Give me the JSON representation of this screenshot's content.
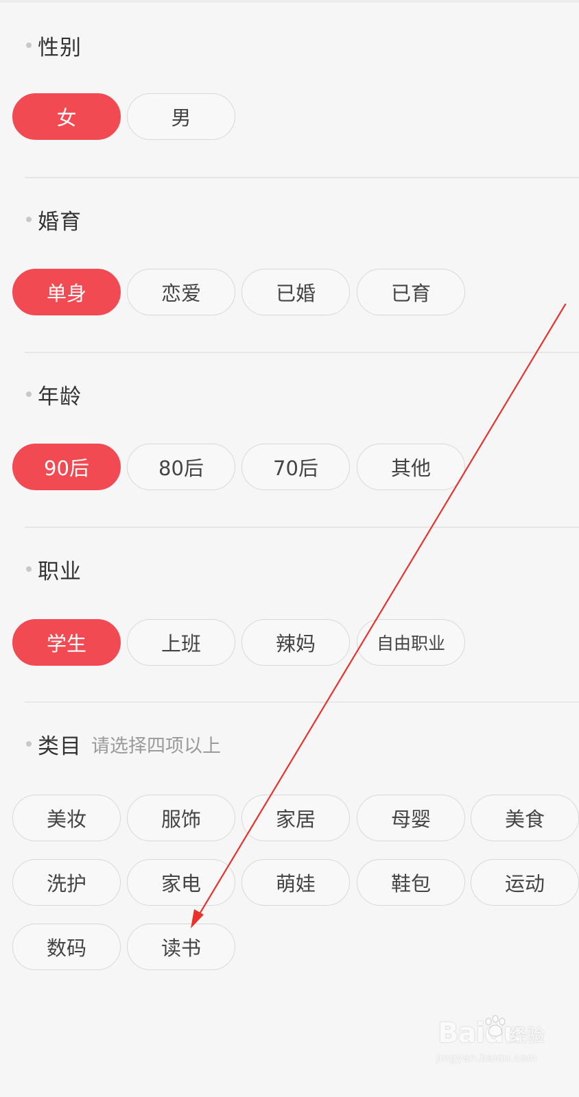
{
  "sections": {
    "gender": {
      "title": "性别",
      "options": [
        "女",
        "男"
      ],
      "selected": "女"
    },
    "marital": {
      "title": "婚育",
      "options": [
        "单身",
        "恋爱",
        "已婚",
        "已育"
      ],
      "selected": "单身"
    },
    "age": {
      "title": "年龄",
      "options": [
        "90后",
        "80后",
        "70后",
        "其他"
      ],
      "selected": "90后"
    },
    "occupation": {
      "title": "职业",
      "options": [
        "学生",
        "上班",
        "辣妈",
        "自由职业"
      ],
      "selected": "学生"
    },
    "category": {
      "title": "类目",
      "hint": "请选择四项以上",
      "options": [
        "美妆",
        "服饰",
        "家居",
        "母婴",
        "美食",
        "洗护",
        "家电",
        "萌娃",
        "鞋包",
        "运动",
        "数码",
        "读书"
      ]
    }
  },
  "watermark": {
    "brand": "Baidu",
    "cn": "经验",
    "url": "jingyan.baidu.com"
  },
  "colors": {
    "accent": "#f24a52",
    "annotation_arrow": "#e8322c"
  },
  "icons": {
    "bullet": "dot-icon",
    "annotation": "arrow-icon"
  }
}
